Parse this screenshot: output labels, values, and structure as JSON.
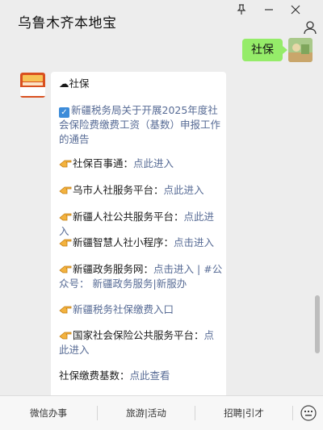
{
  "header": {
    "title": "乌鲁木齐本地宝"
  },
  "chat": {
    "outgoing_message": "社保",
    "incoming": {
      "heading": "☁社保",
      "news_link": "新疆税务局关于开展2025年度社会保险费缴费工资（基数）申报工作的通告",
      "items": [
        {
          "label": "社保百事通：",
          "link": "点此进入"
        },
        {
          "label": "乌市人社服务平台：",
          "link": "点此进入"
        },
        {
          "label": "新疆人社公共服务平台：",
          "link": "点此进入"
        },
        {
          "label": "新疆智慧人社小程序：",
          "link": "点击进入"
        }
      ],
      "gov_label": "新疆政务服务网：",
      "gov_link": "点击进入",
      "gov_sep": "|",
      "gov_hash": "#公众号：",
      "gov_account": "新疆政务服务|新服办",
      "tax_entry": "新疆税务社保缴费入口",
      "national_label": "国家社会保险公共服务平台：",
      "national_link": "点此进入",
      "base_label": "社保缴费基数：",
      "base_link": "点此查看"
    }
  },
  "menu": {
    "items": [
      "微信办事",
      "旅游|活动",
      "招聘|引才"
    ]
  },
  "icons": [
    "pin-icon",
    "minimize-icon",
    "close-icon",
    "person-icon",
    "keyboard-icon",
    "pointing-hand-icon",
    "checkbox-icon"
  ],
  "colors": {
    "outgoing_bubble": "#95ec69",
    "link": "#576b95",
    "background": "#ededed"
  }
}
